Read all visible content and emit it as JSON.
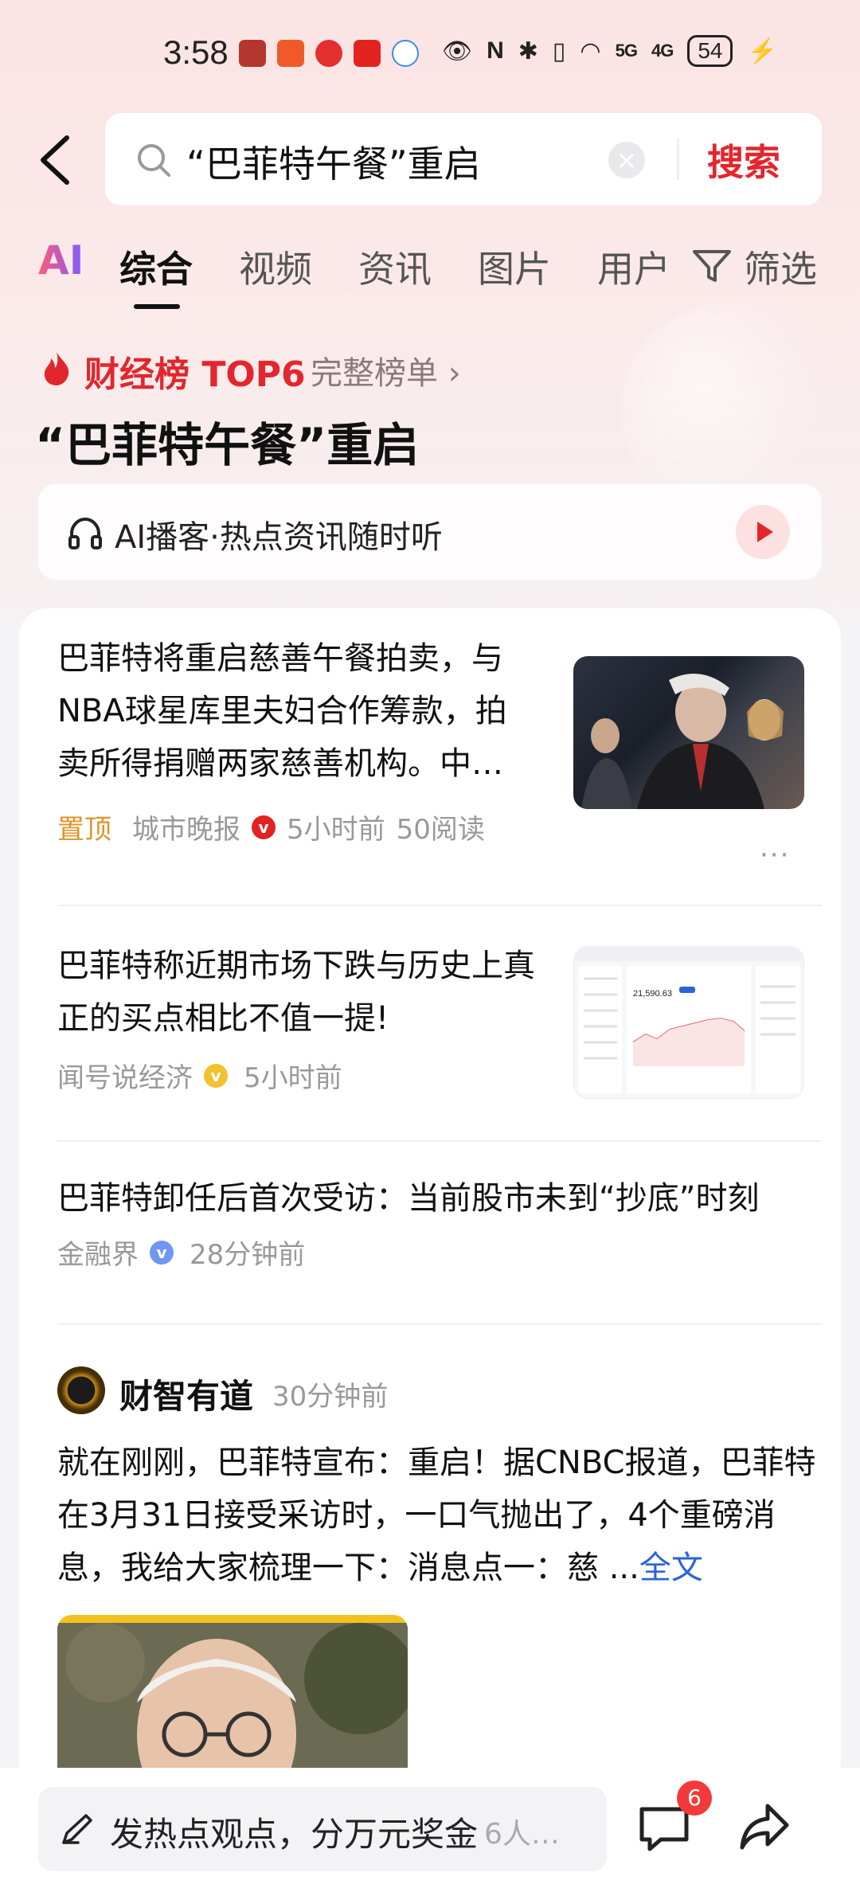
{
  "status": {
    "time": "3:58",
    "signal1": "5G",
    "signal2": "4G",
    "battery": "54"
  },
  "search": {
    "query": "“巴菲特午餐”重启",
    "button": "搜索"
  },
  "tabs": [
    "AI",
    "综合",
    "视频",
    "资讯",
    "图片",
    "用户",
    "筛选"
  ],
  "hot": {
    "title": "财经榜 TOP6",
    "more": "完整榜单 ›",
    "topic": "“巴菲特午餐”重启",
    "podcast": "AI播客·热点资讯随时听"
  },
  "feed": [
    {
      "title": "巴菲特将重启慈善午餐拍卖，与NBA球星库里夫妇合作筹款，拍卖所得捐赠两家慈善机构。中…",
      "tag": "置顶",
      "source": "城市晚报",
      "time": "5小时前",
      "reads": "50阅读",
      "more": "···"
    },
    {
      "title": "巴菲特称近期市场下跌与历史上真正的买点相比不值一提!",
      "source": "闻号说经济",
      "time": "5小时前",
      "thumb_value": "21,590.63"
    },
    {
      "title": "巴菲特卸任后首次受访：当前股市未到“抄底”时刻",
      "source": "金融界",
      "time": "28分钟前"
    }
  ],
  "post": {
    "author": "财智有道",
    "time": "30分钟前",
    "text": "就在刚刚，巴菲特宣布：重启！据CNBC报道，巴菲特在3月31日接受采访时，一口气抛出了，4个重磅消息，我给大家梳理一下：消息点一：慈 ...",
    "fulltext": "全文"
  },
  "bottom": {
    "placeholder": "发热点观点，分万元奖金",
    "count": "6人…",
    "badge": "6"
  },
  "colors": {
    "accent": "#e3262d",
    "link": "#2b63d9",
    "pin": "#e0942a"
  }
}
